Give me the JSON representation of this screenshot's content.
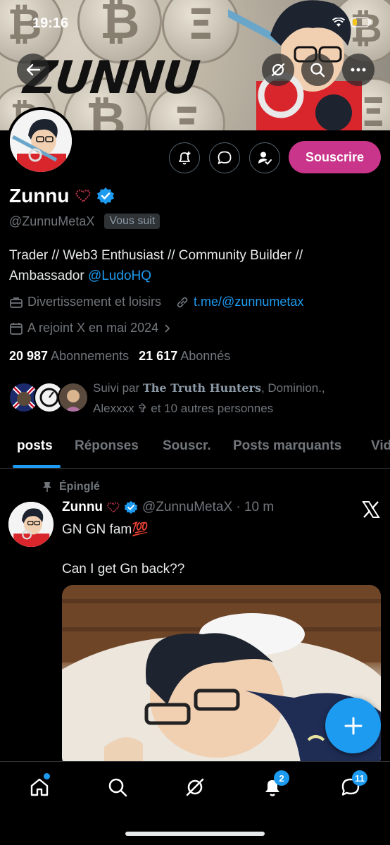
{
  "status_bar": {
    "time": "19:16"
  },
  "banner": {
    "title": "ZUNNU"
  },
  "actions": {
    "subscribe_label": "Souscrire"
  },
  "profile": {
    "name": "Zunnu",
    "handle": "@ZunnuMetaX",
    "follows_you": "Vous suit",
    "bio_text": "Trader // Web3 Enthusiast // Community Builder // Ambassador ",
    "bio_mention": "@LudoHQ",
    "category": "Divertissement et loisirs",
    "website": "t.me/@zunnumetax",
    "joined": "A rejoint X en mai 2024",
    "following_count": "20 987",
    "following_label": "Abonnements",
    "followers_count": "21 617",
    "followers_label": "Abonnés",
    "followed_prefix": "Suivi par ",
    "followed_name1": "The Truth Hunters",
    "followed_rest": ", Dominion., Alexxxx ✞ et 10 autres personnes"
  },
  "tabs": [
    {
      "label": "posts"
    },
    {
      "label": "Réponses"
    },
    {
      "label": "Souscr."
    },
    {
      "label": "Posts marquants"
    },
    {
      "label": "Vid"
    }
  ],
  "post": {
    "pinned_label": "Épinglé",
    "author": "Zunnu",
    "meta": "@ZunnuMetaX · 10 m",
    "line1": "GN GN fam💯",
    "line2": "Can I get Gn back??"
  },
  "bottom_nav": {
    "notifications_badge": "2",
    "messages_badge": "11"
  },
  "colors": {
    "accent": "#1d9bf0",
    "subscribe": "#c9358a",
    "background": "#000000"
  }
}
